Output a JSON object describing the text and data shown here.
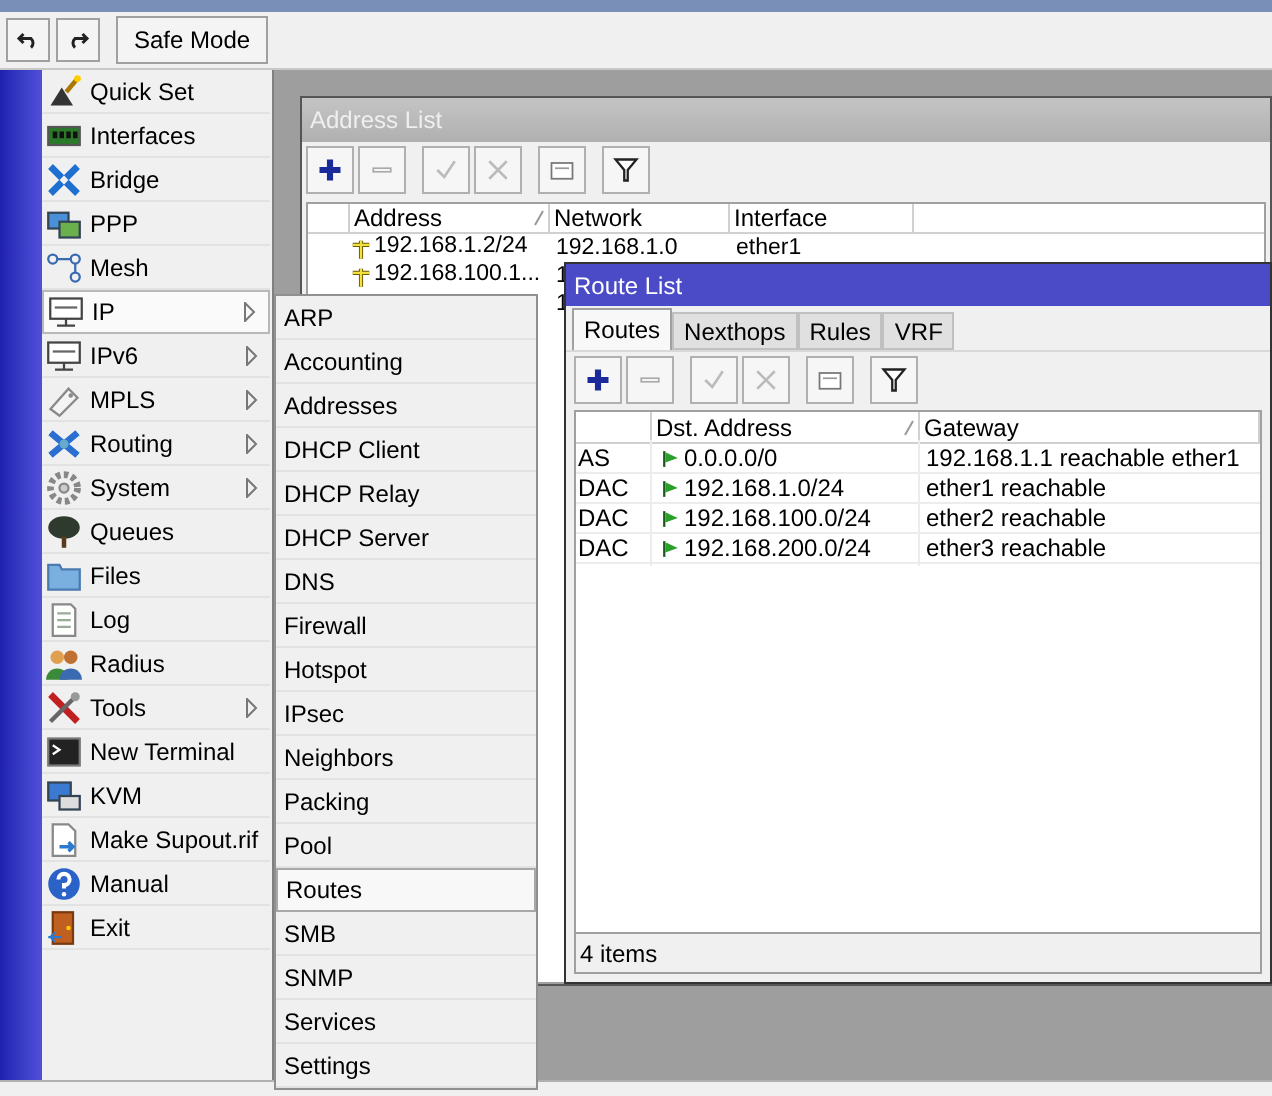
{
  "toolbar": {
    "safe_mode": "Safe Mode"
  },
  "menu": [
    {
      "label": "Quick Set",
      "submenu": false,
      "selected": false
    },
    {
      "label": "Interfaces",
      "submenu": false,
      "selected": false
    },
    {
      "label": "Bridge",
      "submenu": false,
      "selected": false
    },
    {
      "label": "PPP",
      "submenu": false,
      "selected": false
    },
    {
      "label": "Mesh",
      "submenu": false,
      "selected": false
    },
    {
      "label": "IP",
      "submenu": true,
      "selected": true
    },
    {
      "label": "IPv6",
      "submenu": true,
      "selected": false
    },
    {
      "label": "MPLS",
      "submenu": true,
      "selected": false
    },
    {
      "label": "Routing",
      "submenu": true,
      "selected": false
    },
    {
      "label": "System",
      "submenu": true,
      "selected": false
    },
    {
      "label": "Queues",
      "submenu": false,
      "selected": false
    },
    {
      "label": "Files",
      "submenu": false,
      "selected": false
    },
    {
      "label": "Log",
      "submenu": false,
      "selected": false
    },
    {
      "label": "Radius",
      "submenu": false,
      "selected": false
    },
    {
      "label": "Tools",
      "submenu": true,
      "selected": false
    },
    {
      "label": "New Terminal",
      "submenu": false,
      "selected": false
    },
    {
      "label": "KVM",
      "submenu": false,
      "selected": false
    },
    {
      "label": "Make Supout.rif",
      "submenu": false,
      "selected": false
    },
    {
      "label": "Manual",
      "submenu": false,
      "selected": false
    },
    {
      "label": "Exit",
      "submenu": false,
      "selected": false
    }
  ],
  "submenu": {
    "items": [
      {
        "label": "ARP",
        "selected": false
      },
      {
        "label": "Accounting",
        "selected": false
      },
      {
        "label": "Addresses",
        "selected": false
      },
      {
        "label": "DHCP Client",
        "selected": false
      },
      {
        "label": "DHCP Relay",
        "selected": false
      },
      {
        "label": "DHCP Server",
        "selected": false
      },
      {
        "label": "DNS",
        "selected": false
      },
      {
        "label": "Firewall",
        "selected": false
      },
      {
        "label": "Hotspot",
        "selected": false
      },
      {
        "label": "IPsec",
        "selected": false
      },
      {
        "label": "Neighbors",
        "selected": false
      },
      {
        "label": "Packing",
        "selected": false
      },
      {
        "label": "Pool",
        "selected": false
      },
      {
        "label": "Routes",
        "selected": true
      },
      {
        "label": "SMB",
        "selected": false
      },
      {
        "label": "SNMP",
        "selected": false
      },
      {
        "label": "Services",
        "selected": false
      },
      {
        "label": "Settings",
        "selected": false
      }
    ]
  },
  "address_list": {
    "title": "Address List",
    "columns": [
      {
        "label": "Address",
        "sorted": true
      },
      {
        "label": "Network",
        "sorted": false
      },
      {
        "label": "Interface",
        "sorted": false
      }
    ],
    "rows": [
      {
        "address": "192.168.1.2/24",
        "network": "192.168.1.0",
        "interface": "ether1"
      },
      {
        "address": "192.168.100.1...",
        "network": "1"
      },
      {
        "network": "1"
      }
    ]
  },
  "route_list": {
    "title": "Route List",
    "tabs": [
      {
        "label": "Routes",
        "selected": true
      },
      {
        "label": "Nexthops",
        "selected": false
      },
      {
        "label": "Rules",
        "selected": false
      },
      {
        "label": "VRF",
        "selected": false
      }
    ],
    "columns": [
      {
        "label": "Dst. Address",
        "sorted": true
      },
      {
        "label": "Gateway",
        "sorted": false
      }
    ],
    "rows": [
      {
        "flags": "AS",
        "dst": "0.0.0.0/0",
        "gateway": "192.168.1.1 reachable ether1"
      },
      {
        "flags": "DAC",
        "dst": "192.168.1.0/24",
        "gateway": "ether1 reachable"
      },
      {
        "flags": "DAC",
        "dst": "192.168.100.0/24",
        "gateway": "ether2 reachable"
      },
      {
        "flags": "DAC",
        "dst": "192.168.200.0/24",
        "gateway": "ether3 reachable"
      }
    ],
    "status": "4 items"
  }
}
